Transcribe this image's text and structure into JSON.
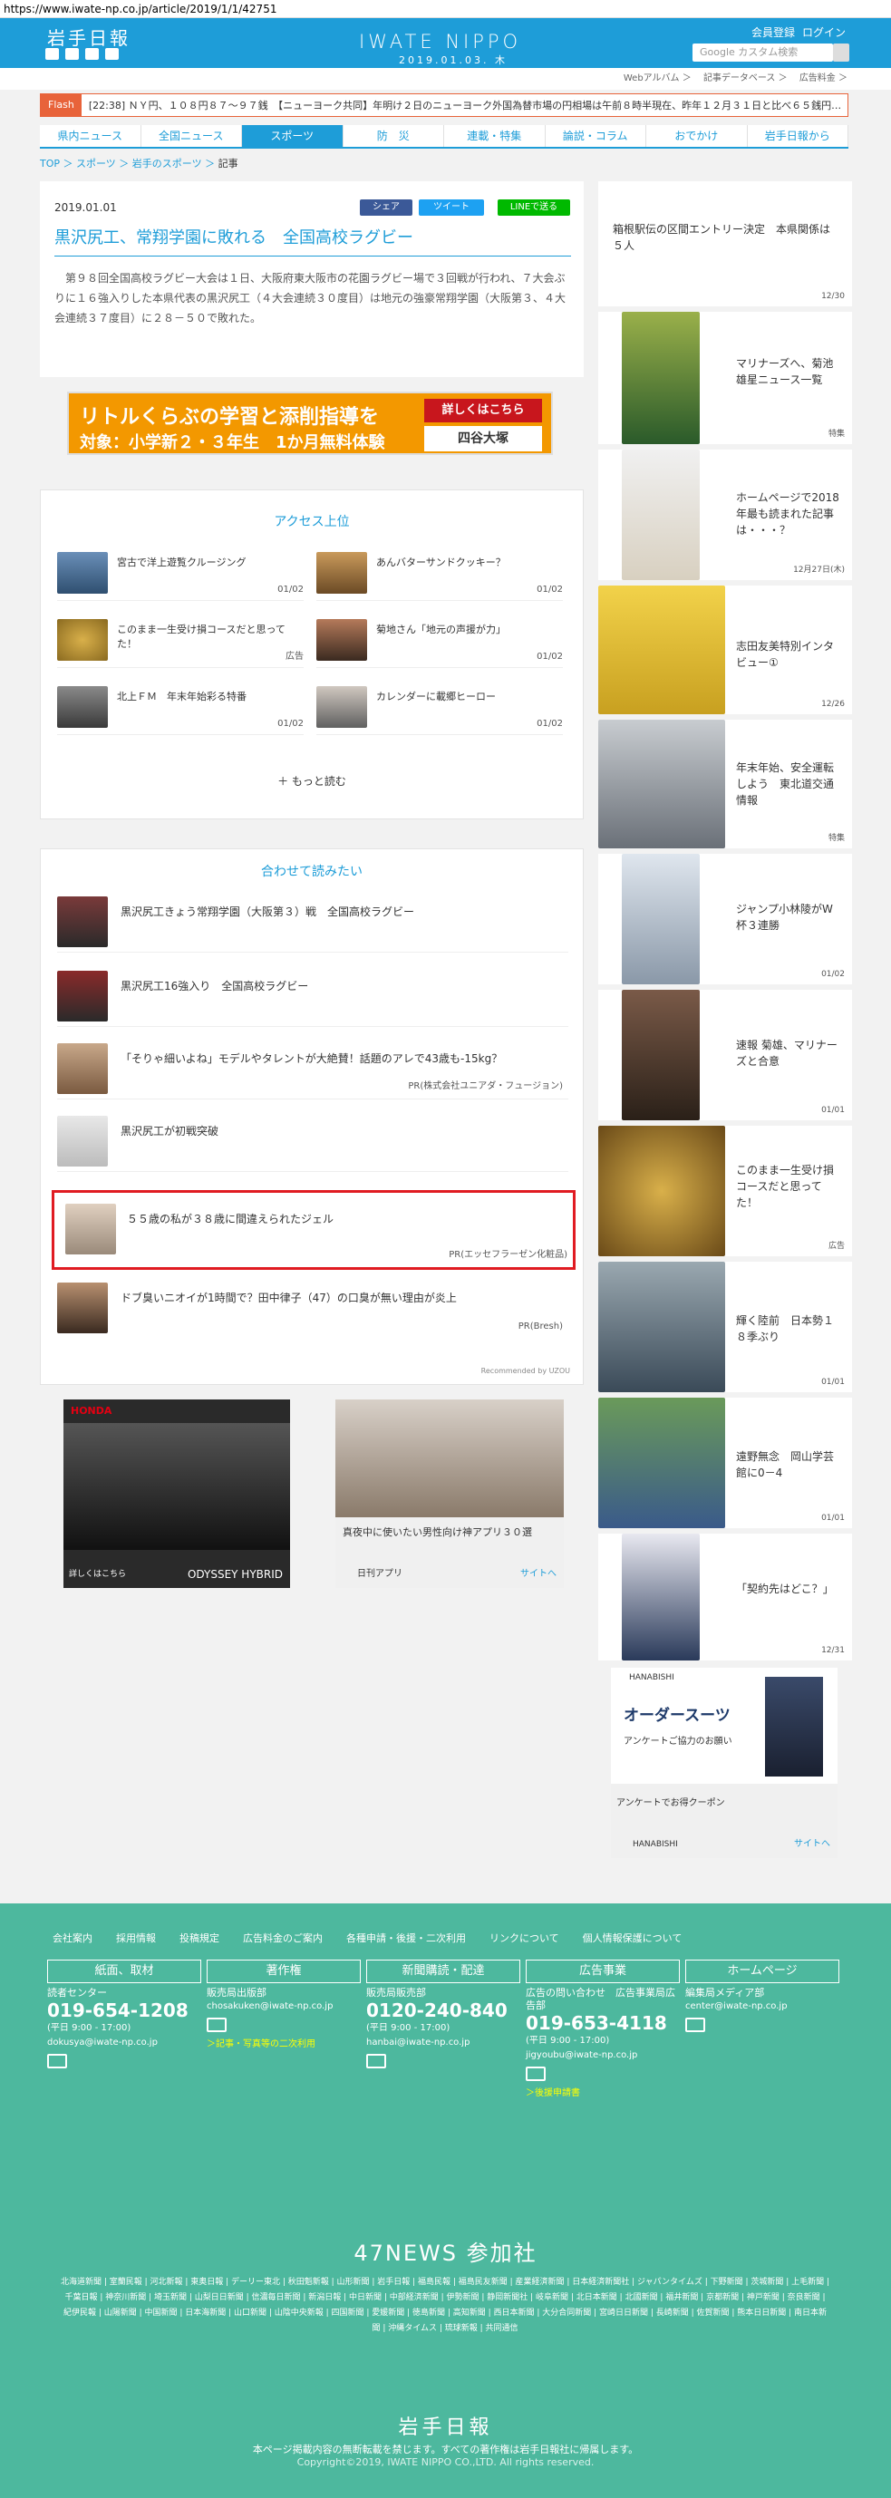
{
  "url": "https://www.iwate-np.co.jp/article/2019/1/1/42751",
  "header": {
    "logo": "岩手日報",
    "brand": "IWATE NIPPO",
    "date": "2019.01.03. 木",
    "links": [
      "会員登録",
      "ログイン"
    ],
    "search_placeholder": "Google カスタム検索",
    "sublinks": [
      "Webアルバム ＞",
      "記事データベース ＞",
      "広告料金 ＞"
    ]
  },
  "flash": {
    "tag": "Flash",
    "text": "[22:38] ＮＹ円、１０８円８７～９７銭　【ニューヨーク共同】年明け２日のニューヨーク外国為替市場の円相場は午前８時半現在、昨年１２月３１日と比べ６５銭円…"
  },
  "nav": [
    "県内ニュース",
    "全国ニュース",
    "スポーツ",
    "防　災",
    "連載・特集",
    "論説・コラム",
    "おでかけ",
    "岩手日報から"
  ],
  "crumbs": {
    "top": "TOP",
    "sports": "スポーツ",
    "iwate_sports": "岩手のスポーツ",
    "current": "記事"
  },
  "article": {
    "date": "2019.01.01",
    "share": "シェア",
    "tweet": "ツイート",
    "line": "LINEで送る",
    "title": "黒沢尻工、常翔学園に敗れる　全国高校ラグビー",
    "body": "　第９８回全国高校ラグビー大会は１日、大阪府東大阪市の花園ラグビー場で３回戦が行われ、７大会ぶりに１６強入りした本県代表の黒沢尻工（４大会連続３０度目）は地元の強豪常翔学園（大阪第３、４大会連続３７度目）に２８－５０で敗れた。"
  },
  "ad": {
    "line1": "リトルくらぶの学習と添削指導を",
    "line2": "対象：小学新２・３年生　1か月無料体験",
    "btn": "詳しくはこちら",
    "brand": "四谷大塚"
  },
  "ranking": {
    "title": "アクセス上位",
    "more": "もっと読む",
    "items": [
      {
        "title": "宮古で洋上遊覧クルージング",
        "date": "01/02"
      },
      {
        "title": "あんバターサンドクッキー？",
        "date": "01/02"
      },
      {
        "title": "このまま一生受け損コースだと思ってた！",
        "date": "広告"
      },
      {
        "title": "菊地さん「地元の声援が力」",
        "date": "01/02"
      },
      {
        "title": "北上ＦＭ　年末年始彩る特番",
        "date": "01/02"
      },
      {
        "title": "カレンダーに載郷ヒーロー",
        "date": "01/02"
      }
    ]
  },
  "related": {
    "title": "合わせて読みたい",
    "items": [
      {
        "title": "黒沢尻工きょう常翔学園（大阪第３）戦　全国高校ラグビー",
        "pr": ""
      },
      {
        "title": "黒沢尻工16強入り　全国高校ラグビー",
        "pr": ""
      },
      {
        "title": "「そりゃ細いよね」モデルやタレントが大絶賛！話題のアレで43歳も-15kg？",
        "pr": "PR(株式会社ユニアダ・フュージョン)"
      },
      {
        "title": "黒沢尻工が初戦突破",
        "pr": ""
      },
      {
        "title": "５５歳の私が３８歳に間違えられたジェル",
        "pr": "PR(エッセフラーゼン化粧品)"
      },
      {
        "title": "ドブ臭いニオイが1時間で？田中律子（47）の口臭が無い理由が炎上",
        "pr": "PR(Bresh)"
      }
    ],
    "recommended": "Recommended by UZOU"
  },
  "ads2": {
    "honda": "HONDA",
    "odyssey": "ODYSSEY HYBRID",
    "detail": "詳しくはこちら",
    "ad2_title": "真夜中に使いたい男性向け神アプリ３０選",
    "ad2_src": "日刊アプリ",
    "ad2_link": "サイトへ"
  },
  "sidebar": [
    {
      "title": "箱根駅伝の区間エントリー決定　本県関係は５人",
      "date": "12/30"
    },
    {
      "title": "マリナーズへ、菊池雄星ニュース一覧",
      "date": "特集"
    },
    {
      "title": "ホームページで2018年最も読まれた記事は・・・？",
      "date": "12月27日(木)"
    },
    {
      "title": "志田友美特別インタビュー①",
      "date": "12/26"
    },
    {
      "title": "年末年始、安全運転しよう　東北道交通情報",
      "date": "特集"
    },
    {
      "title": "ジャンプ小林陵がW杯３連勝",
      "date": "01/02"
    },
    {
      "title": "速報 菊雄、マリナーズと合意",
      "date": "01/01"
    },
    {
      "title": "このまま一生受け損コースだと思ってた！",
      "date": "広告"
    },
    {
      "title": "輝く陸前　日本勢１８季ぶり",
      "date": "01/01"
    },
    {
      "title": "遠野無念　岡山学芸館に0－4",
      "date": "01/01"
    },
    {
      "title": "「契約先はどこ？」",
      "date": "12/31"
    }
  ],
  "side_ad": {
    "brand": "HANABISHI",
    "title": "オーダースーツ",
    "sub": "アンケートご協力のお願い",
    "coupon": "アンケートでお得クーポン",
    "link": "サイトへ"
  },
  "footer": {
    "links": [
      "会社案内",
      "採用情報",
      "投稿規定",
      "広告料金のご案内",
      "各種申請・後援・二次利用",
      "リンクについて",
      "個人情報保護について"
    ],
    "cols": [
      {
        "hd": "紙面、取材",
        "sm": "読者センター",
        "tel": "019-654-1208",
        "hours": "(平日 9:00 - 17:00)",
        "mail": "dokusya@iwate-np.co.jp",
        "extra": ""
      },
      {
        "hd": "著作権",
        "sm": "販売局出版部",
        "tel": "",
        "hours": "",
        "mail": "chosakuken@iwate-np.co.jp",
        "extra": "＞記事・写真等の二次利用"
      },
      {
        "hd": "新聞購読・配達",
        "sm": "販売局販売部",
        "tel": "0120-240-840",
        "hours": "(平日 9:00 - 17:00)",
        "mail": "hanbai@iwate-np.co.jp",
        "extra": ""
      },
      {
        "hd": "広告事業",
        "sm": "広告の問い合わせ　広告事業局広告部",
        "tel": "019-653-4118",
        "hours": "(平日 9:00 - 17:00)",
        "mail": "jigyoubu@iwate-np.co.jp",
        "extra": "＞後援申請書"
      },
      {
        "hd": "ホームページ",
        "sm": "編集局メディア部",
        "tel": "",
        "hours": "",
        "mail": "center@iwate-np.co.jp",
        "extra": ""
      }
    ],
    "news47": "47NEWS 参加社",
    "newslist": "北海道新聞 | 室蘭民報 | 河北新報 | 東奥日報 | デーリー東北 | 秋田魁新報 | 山形新聞 | 岩手日報 | 福島民報 | 福島民友新聞 | 産業経済新聞 | 日本経済新聞社 | ジャパンタイムズ | 下野新聞 | 茨城新聞 | 上毛新聞 | 千葉日報 | 神奈川新聞 | 埼玉新聞 | 山梨日日新聞 | 信濃毎日新聞 | 新潟日報 | 中日新聞 | 中部経済新聞 | 伊勢新聞 | 静岡新聞社 | 岐阜新聞 | 北日本新聞 | 北國新聞 | 福井新聞 | 京都新聞 | 神戸新聞 | 奈良新聞 | 紀伊民報 | 山陽新聞 | 中国新聞 | 日本海新聞 | 山口新聞 | 山陰中央新報 | 四国新聞 | 愛媛新聞 | 徳島新聞 | 高知新聞 | 西日本新聞 | 大分合同新聞 | 宮崎日日新聞 | 長崎新聞 | 佐賀新聞 | 熊本日日新聞 | 南日本新聞 | 沖縄タイムス | 琉球新報 | 共同通信",
    "logo": "岩手日報",
    "copy1": "本ページ掲載内容の無断転載を禁じます。すべての著作権は岩手日報社に帰属します。",
    "copy2": "Copyright©2019, IWATE NIPPO CO.,LTD. All rights reserved."
  }
}
